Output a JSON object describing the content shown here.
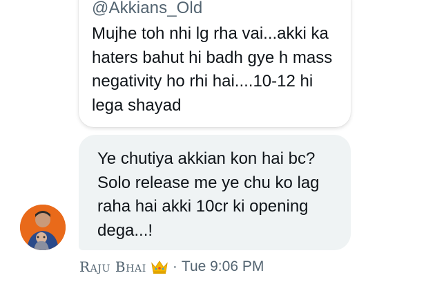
{
  "quoted_message": {
    "handle": "@Akkians_Old",
    "text": "Mujhe toh nhi lg rha vai...akki ka haters bahut hi badh gye h mass negativity ho rhi hai....10-12 hi lega shayad"
  },
  "message": {
    "text": "Ye chutiya akkian kon hai bc? Solo release me ye chu ko lag raha hai akki 10cr ki opening dega...!"
  },
  "sender": {
    "name": "Raju Bhai",
    "badge_icon": "crown-icon"
  },
  "meta": {
    "separator": "·",
    "time": "Tue 9:06 PM"
  },
  "colors": {
    "bubble_bg": "#eff3f4",
    "text_primary": "#0f1419",
    "text_secondary": "#536471",
    "avatar_bg": "#e96a1a",
    "crown": "#f5b800"
  }
}
